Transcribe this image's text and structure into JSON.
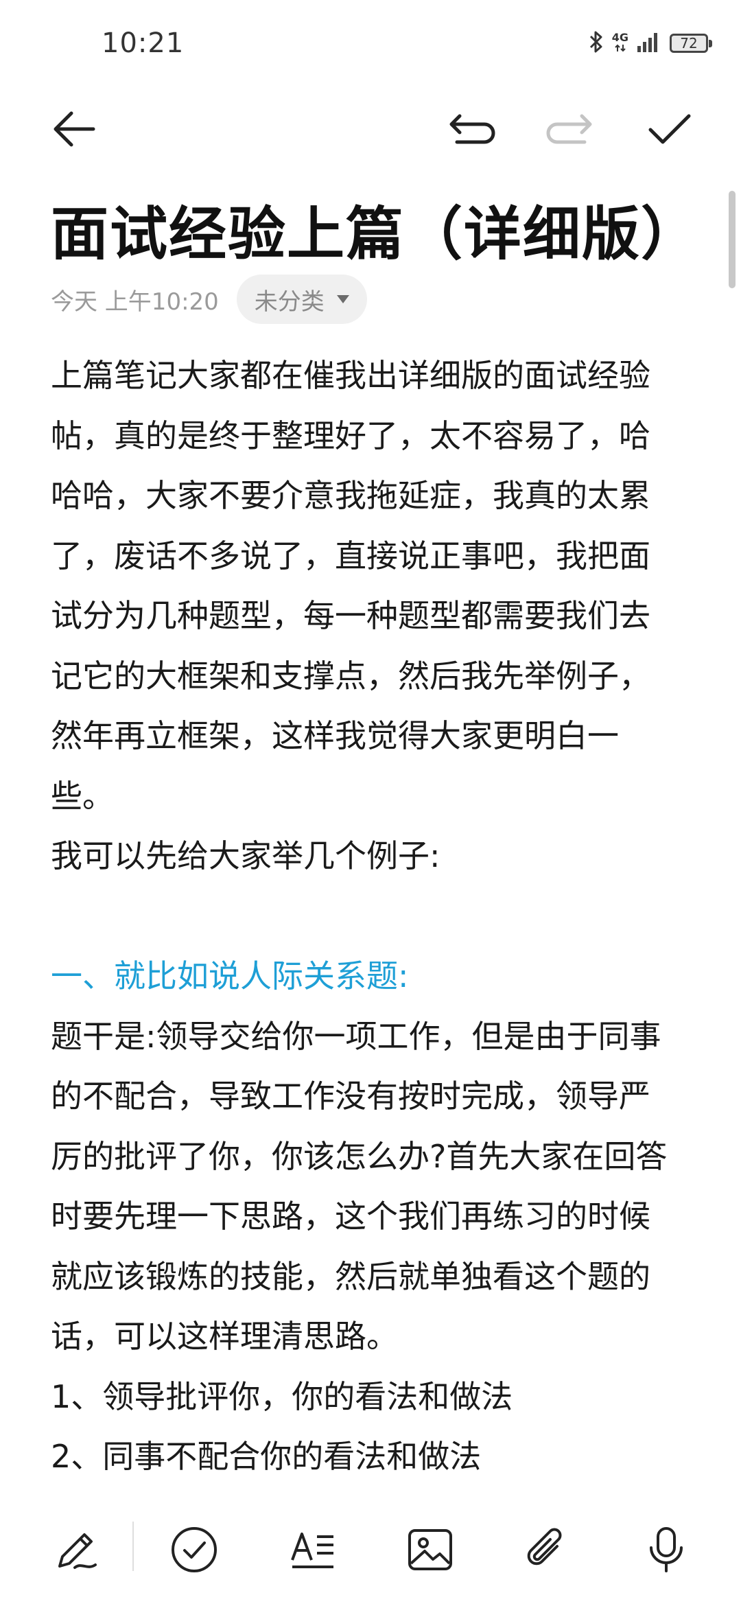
{
  "status_bar": {
    "time": "10:21",
    "network": "4G",
    "battery": "72"
  },
  "toolbar": {
    "back_icon": "arrow-left-icon",
    "undo_icon": "undo-icon",
    "redo_icon": "redo-icon",
    "confirm_icon": "check-icon"
  },
  "note": {
    "title": "面试经验上篇（详细版）",
    "timestamp": "今天 上午10:20",
    "category": "未分类",
    "lines": [
      "上篇笔记大家都在催我出详细版的面试经验",
      "帖，真的是终于整理好了，太不容易了，哈",
      "哈哈，大家不要介意我拖延症，我真的太累",
      "了，废话不多说了，直接说正事吧，我把面",
      "试分为几种题型，每一种题型都需要我们去",
      "记它的大框架和支撑点，然后我先举例子，",
      "然年再立框架，这样我觉得大家更明白一",
      "些。",
      "我可以先给大家举几个例子:",
      "",
      "一、就比如说人际关系题:",
      "题干是:领导交给你一项工作，但是由于同事",
      "的不配合，导致工作没有按时完成，领导严",
      "厉的批评了你，你该怎么办?首先大家在回答",
      "时要先理一下思路，这个我们再练习的时候",
      "就应该锻炼的技能，然后就单独看这个题的",
      "话，可以这样理清思路。",
      "1、领导批评你，你的看法和做法",
      "2、同事不配合你的看法和做法"
    ],
    "heading_color": "#1e9fd6"
  },
  "bottom_toolbar": {
    "items": [
      "pen-icon",
      "checklist-icon",
      "text-format-icon",
      "image-icon",
      "attachment-icon",
      "microphone-icon"
    ]
  }
}
